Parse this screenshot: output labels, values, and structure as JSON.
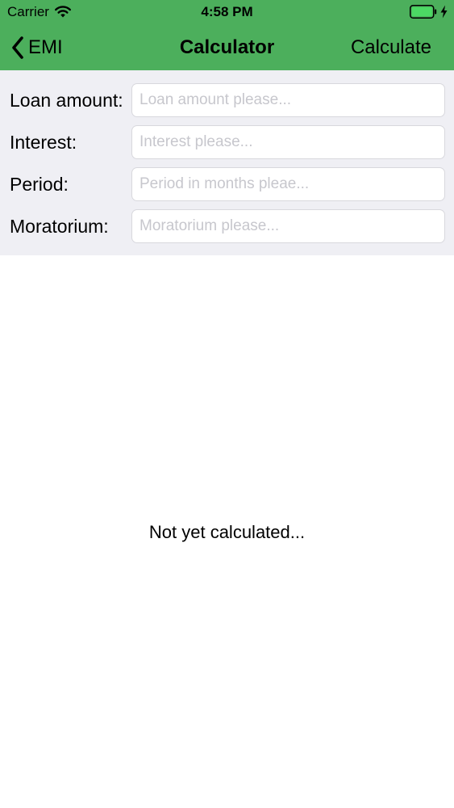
{
  "status_bar": {
    "carrier": "Carrier",
    "time": "4:58 PM",
    "wifi_icon": "wifi-icon",
    "battery_icon": "battery-full-icon",
    "charging_icon": "charging-bolt-icon"
  },
  "nav": {
    "back_label": "EMI",
    "back_icon": "chevron-left-icon",
    "title": "Calculator",
    "action_label": "Calculate"
  },
  "form": {
    "loan_amount": {
      "label": "Loan amount:",
      "placeholder": "Loan amount please...",
      "value": ""
    },
    "interest": {
      "label": "Interest:",
      "placeholder": "Interest please...",
      "value": ""
    },
    "period": {
      "label": "Period:",
      "placeholder": "Period in months pleae...",
      "value": ""
    },
    "moratorium": {
      "label": "Moratorium:",
      "placeholder": "Moratorium please...",
      "value": ""
    }
  },
  "result": {
    "text": "Not yet calculated..."
  },
  "colors": {
    "nav_bar": "#4caf5c",
    "form_background": "#efeff4",
    "battery_fill": "#4cd964"
  }
}
